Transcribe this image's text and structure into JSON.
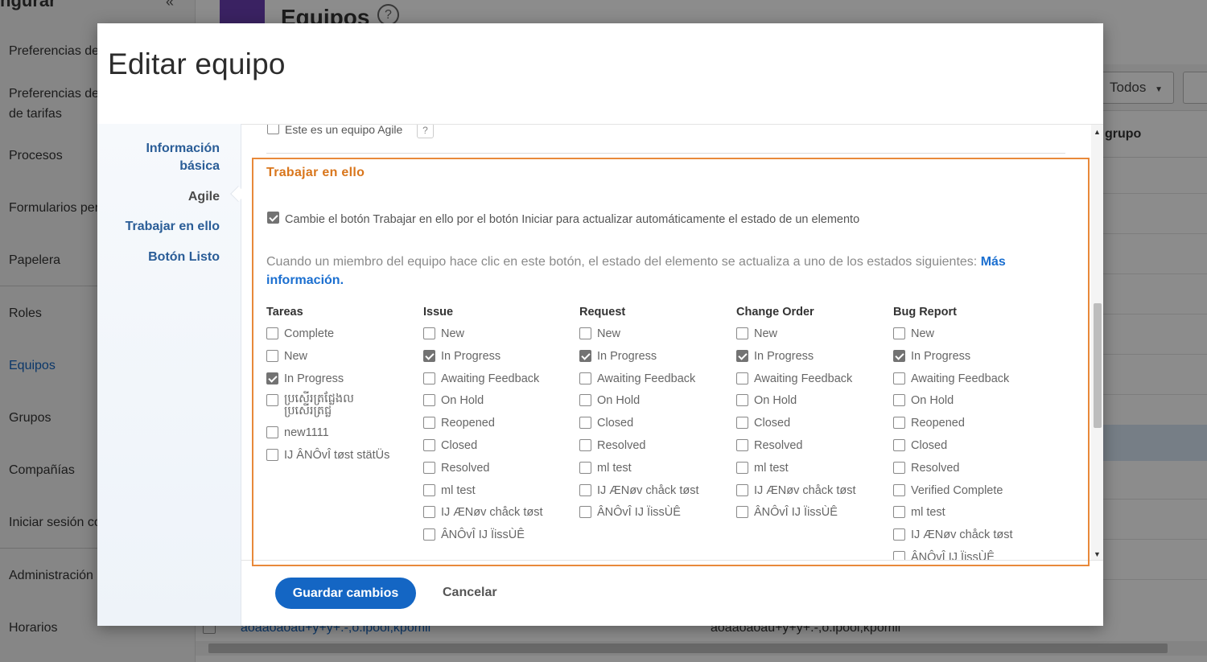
{
  "background": {
    "sidebar": {
      "header": "ngurar",
      "collapse_icon": "«",
      "items": [
        {
          "label": "Preferencias de"
        },
        {
          "label": "Preferencias de de tarifas"
        },
        {
          "label": "Procesos"
        },
        {
          "label": "Formularios per"
        },
        {
          "label": "Papelera"
        },
        {
          "label": "Roles"
        },
        {
          "label": "Equipos"
        },
        {
          "label": "Grupos"
        },
        {
          "label": "Compañías"
        },
        {
          "label": "Iniciar sesión co"
        },
        {
          "label": "Administración"
        },
        {
          "label": "Horarios"
        }
      ],
      "active_item": "Equipos"
    },
    "page_title": "Equipos",
    "help_icon": "?",
    "filter_dropdown": "Todos",
    "column_header": "grupo",
    "bottom_row": {
      "name": "aoaaoaoau+y+y+.-,o.ipooi,kpomil",
      "value": "aoaaoaoau+y+y+.-,o.ipooi,kpomil"
    }
  },
  "modal": {
    "title": "Editar equipo",
    "nav": [
      {
        "label": "Información básica",
        "current": false
      },
      {
        "label": "Agile",
        "current": true
      },
      {
        "label": "Trabajar en ello",
        "current": false
      },
      {
        "label": "Botón Listo",
        "current": false
      }
    ],
    "agile_checkbox": {
      "label": "Este es un equipo Agile",
      "checked": false,
      "help": "?"
    },
    "section_title": "Trabajar en ello",
    "change_button_checkbox": {
      "label": "Cambie el botón Trabajar en ello por el botón Iniciar para actualizar automáticamente el estado de un elemento",
      "checked": true
    },
    "info_text": "Cuando un miembro del equipo hace clic en este botón, el estado del elemento se actualiza a uno de los estados siguientes: ",
    "info_link": "Más información.",
    "columns": [
      {
        "title": "Tareas",
        "options": [
          {
            "label": "Complete",
            "checked": false
          },
          {
            "label": "New",
            "checked": false
          },
          {
            "label": "In Progress",
            "checked": true
          },
          {
            "label": "ប្រសើរត្រជ្លែងល ប្រសើរត្រជ្ល",
            "checked": false
          },
          {
            "label": "new1111",
            "checked": false
          },
          {
            "label": "IJ ÂNÔvÎ tøst stätÜs",
            "checked": false
          }
        ]
      },
      {
        "title": "Issue",
        "options": [
          {
            "label": "New",
            "checked": false
          },
          {
            "label": "In Progress",
            "checked": true
          },
          {
            "label": "Awaiting Feedback",
            "checked": false
          },
          {
            "label": "On Hold",
            "checked": false
          },
          {
            "label": "Reopened",
            "checked": false
          },
          {
            "label": "Closed",
            "checked": false
          },
          {
            "label": "Resolved",
            "checked": false
          },
          {
            "label": "ml test",
            "checked": false
          },
          {
            "label": "IJ ÆNøv chåck tøst",
            "checked": false
          },
          {
            "label": "ÂNÔvÎ IJ ÏissÙÊ",
            "checked": false
          }
        ]
      },
      {
        "title": "Request",
        "options": [
          {
            "label": "New",
            "checked": false
          },
          {
            "label": "In Progress",
            "checked": true
          },
          {
            "label": "Awaiting Feedback",
            "checked": false
          },
          {
            "label": "On Hold",
            "checked": false
          },
          {
            "label": "Closed",
            "checked": false
          },
          {
            "label": "Resolved",
            "checked": false
          },
          {
            "label": "ml test",
            "checked": false
          },
          {
            "label": "IJ ÆNøv chåck tøst",
            "checked": false
          },
          {
            "label": "ÂNÔvÎ IJ ÏissÙÊ",
            "checked": false
          }
        ]
      },
      {
        "title": "Change Order",
        "options": [
          {
            "label": "New",
            "checked": false
          },
          {
            "label": "In Progress",
            "checked": true
          },
          {
            "label": "Awaiting Feedback",
            "checked": false
          },
          {
            "label": "On Hold",
            "checked": false
          },
          {
            "label": "Closed",
            "checked": false
          },
          {
            "label": "Resolved",
            "checked": false
          },
          {
            "label": "ml test",
            "checked": false
          },
          {
            "label": "IJ ÆNøv chåck tøst",
            "checked": false
          },
          {
            "label": "ÂNÔvÎ IJ ÏissÙÊ",
            "checked": false
          }
        ]
      },
      {
        "title": "Bug Report",
        "options": [
          {
            "label": "New",
            "checked": false
          },
          {
            "label": "In Progress",
            "checked": true
          },
          {
            "label": "Awaiting Feedback",
            "checked": false
          },
          {
            "label": "On Hold",
            "checked": false
          },
          {
            "label": "Reopened",
            "checked": false
          },
          {
            "label": "Closed",
            "checked": false
          },
          {
            "label": "Resolved",
            "checked": false
          },
          {
            "label": "Verified Complete",
            "checked": false
          },
          {
            "label": "ml test",
            "checked": false
          },
          {
            "label": "IJ ÆNøv chåck tøst",
            "checked": false
          },
          {
            "label": "ÂNÔvÎ IJ ÏissÙÊ",
            "checked": false
          }
        ]
      }
    ],
    "save_button": "Guardar cambios",
    "cancel_button": "Cancelar",
    "colors": {
      "accent": "#1466c4",
      "section_title": "#d9761c",
      "highlight_border": "#e8893a"
    }
  }
}
